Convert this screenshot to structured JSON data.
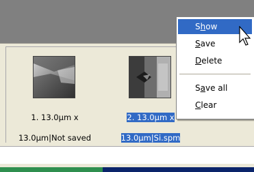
{
  "thumbnails": [
    {
      "caption_line1": "1. 13.0µm x",
      "caption_line2": "13.0µm|Not saved",
      "selected": false,
      "icon": "scan-image-thumbnail"
    },
    {
      "caption_line1": "2. 13.0µm x",
      "caption_line2": "13.0µm|Si.spm",
      "selected": true,
      "icon": "scan-image-thumbnail"
    }
  ],
  "context_menu": {
    "items": [
      {
        "label": "Show",
        "access_key": "h",
        "highlighted": true
      },
      {
        "label": "Save",
        "access_key": "S",
        "highlighted": false
      },
      {
        "label": "Delete",
        "access_key": "D",
        "highlighted": false
      },
      {
        "label": "Save all",
        "access_key": "a",
        "highlighted": false
      },
      {
        "label": "Clear",
        "access_key": "C",
        "highlighted": false
      }
    ]
  },
  "colors": {
    "selection": "#316ac5",
    "panel_gray": "#808080",
    "window_bg": "#ece9d8"
  },
  "cursor_icon": "arrow-pointer-icon"
}
